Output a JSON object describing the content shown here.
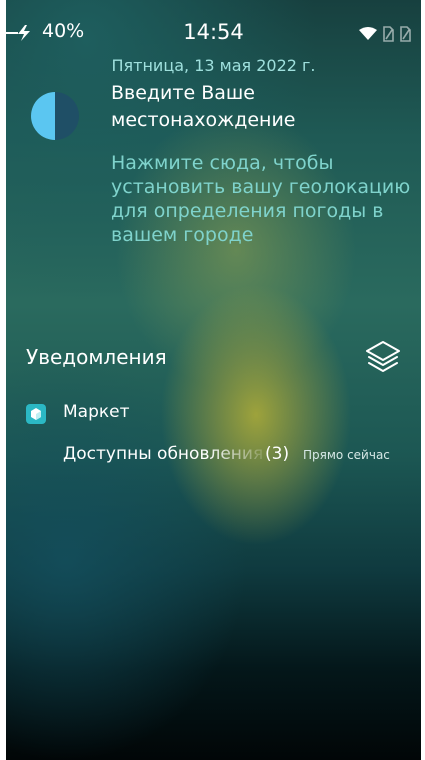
{
  "status_bar": {
    "battery_percent": "40%",
    "time": "14:54",
    "icons": [
      "charging-icon",
      "wifi-icon",
      "sim1-icon",
      "sim2-icon"
    ]
  },
  "date": "Пятница, 13 мая 2022 г.",
  "weather": {
    "icon": "moon-half-icon",
    "title": "Введите Ваше местонахождение",
    "hint": "Нажмите сюда, чтобы установить вашу геолокацию для определения погоды в вашем городе"
  },
  "notifications": {
    "header": "Уведомления",
    "clear_icon": "layers-icon",
    "items": [
      {
        "app": "Маркет",
        "text": "Доступны обновления",
        "count": "(3)",
        "time": "Прямо сейчас"
      }
    ]
  },
  "colors": {
    "accent_text": "#7fd3cc",
    "app_icon": "#2bb8c4",
    "moon_light": "#5bc6f1",
    "moon_dark": "#1f4f66"
  }
}
